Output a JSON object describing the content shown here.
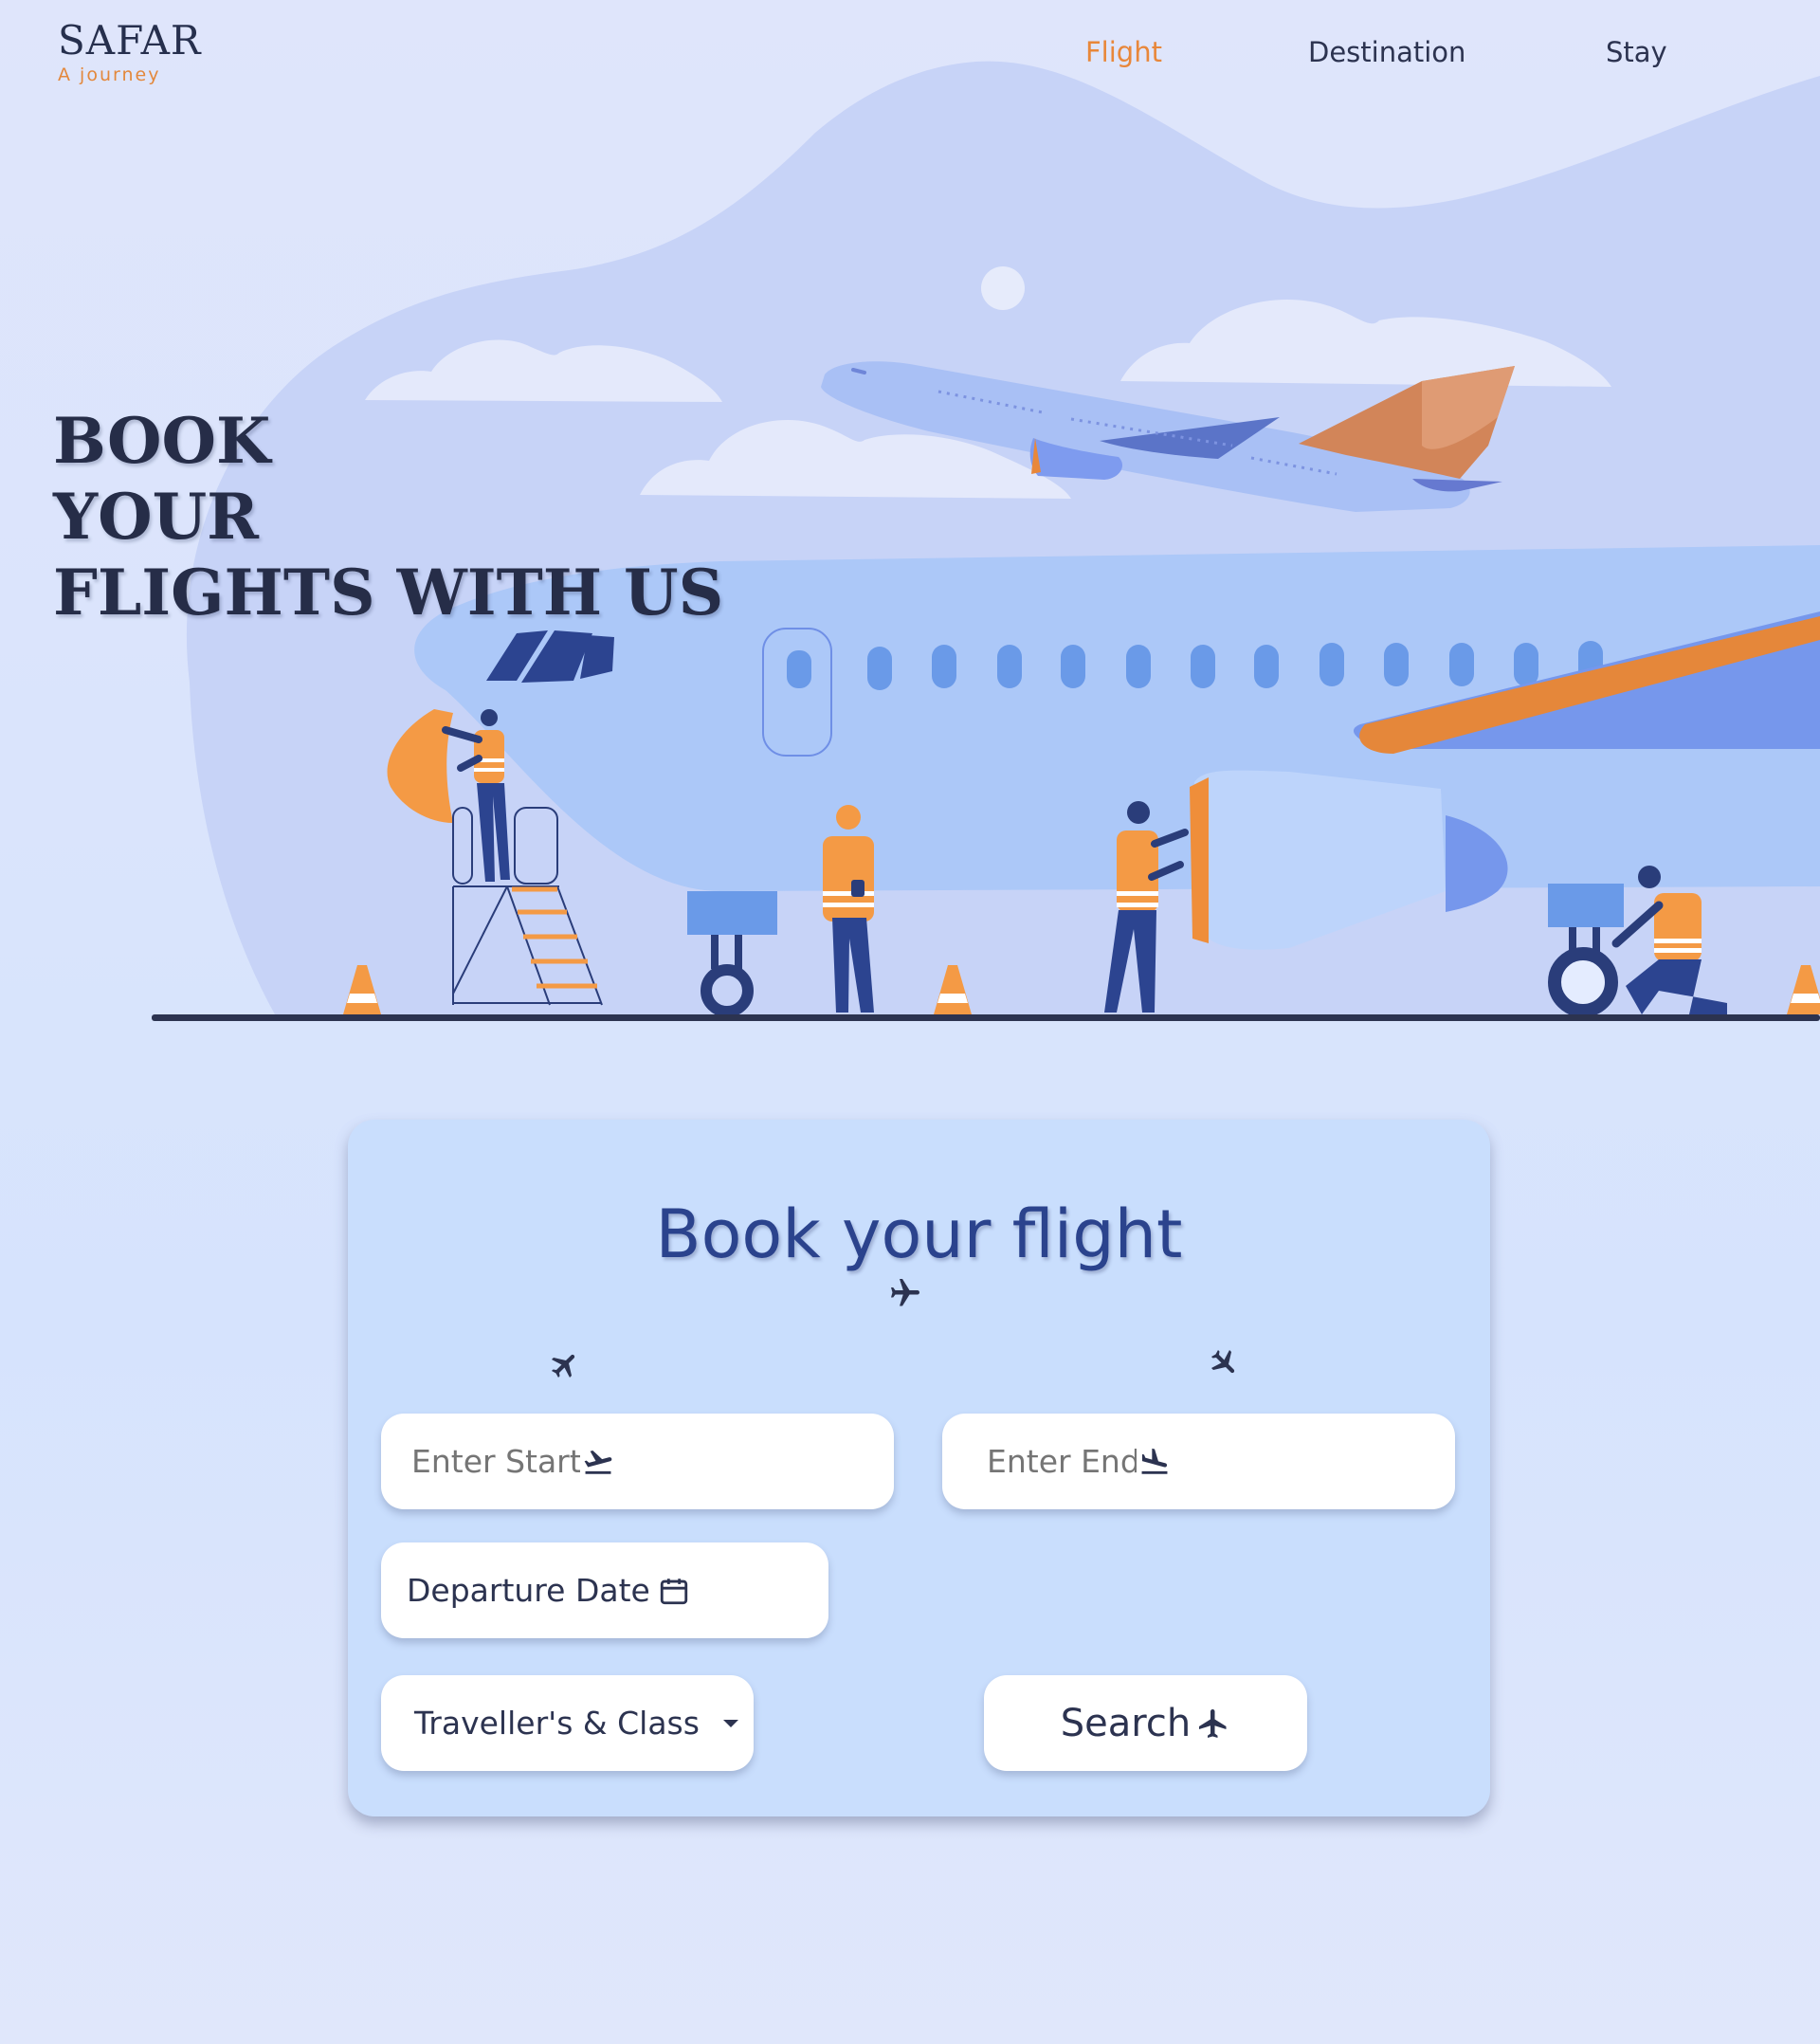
{
  "brand": {
    "name": "SAFAR",
    "tagline": "A journey"
  },
  "nav": {
    "items": [
      "Flight",
      "Destination",
      "Stay"
    ],
    "active": "Flight",
    "active_color": "#e8873a"
  },
  "hero": {
    "title_lines": [
      "BOOK",
      "YOUR",
      "FLIGHTS WITH US"
    ]
  },
  "booking": {
    "title": "Book your flight",
    "start": {
      "placeholder": "Enter Start",
      "icon": "flight-takeoff-icon"
    },
    "end": {
      "placeholder": "Enter End",
      "icon": "flight-land-icon"
    },
    "departure": {
      "label": "Departure Date",
      "icon": "calendar-icon"
    },
    "travellers": {
      "label": "Traveller's & Class",
      "icon": "caret-down-icon"
    },
    "search": {
      "label": "Search",
      "icon": "airplane-icon"
    }
  },
  "colors": {
    "accent": "#e8873a",
    "text": "#262f4d",
    "card": "#c9defd",
    "heading": "#2b438d"
  }
}
